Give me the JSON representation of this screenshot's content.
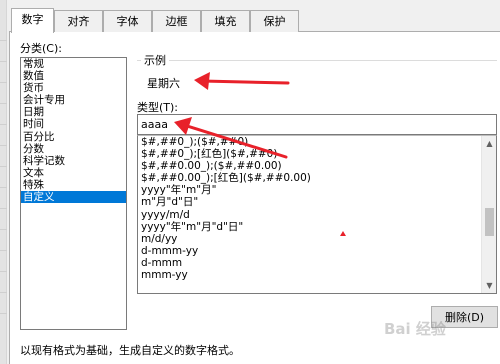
{
  "tabs": [
    {
      "label": "数字",
      "active": true
    },
    {
      "label": "对齐",
      "active": false
    },
    {
      "label": "字体",
      "active": false
    },
    {
      "label": "边框",
      "active": false
    },
    {
      "label": "填充",
      "active": false
    },
    {
      "label": "保护",
      "active": false
    }
  ],
  "category": {
    "label": "分类(C):",
    "items": [
      "常规",
      "数值",
      "货币",
      "会计专用",
      "日期",
      "时间",
      "百分比",
      "分数",
      "科学记数",
      "文本",
      "特殊",
      "自定义"
    ],
    "selected": "自定义"
  },
  "sample": {
    "title": "示例",
    "value": "星期六"
  },
  "type": {
    "label": "类型(T):",
    "value": "aaaa"
  },
  "formats": [
    "$#,##0_);($#,##0)",
    "$#,##0_);[红色]($#,##0)",
    "$#,##0.00_);($#,##0.00)",
    "$#,##0.00_);[红色]($#,##0.00)",
    "yyyy\"年\"m\"月\"",
    "m\"月\"d\"日\"",
    "yyyy/m/d",
    "yyyy\"年\"m\"月\"d\"日\"",
    "m/d/yy",
    "d-mmm-yy",
    "d-mmm",
    "mmm-yy"
  ],
  "delete_button": "删除(D)",
  "note": "以现有格式为基础，生成自定义的数字格式。",
  "watermark": "Bai 经验",
  "colors": {
    "selection": "#0078d7",
    "annotation_arrow": "#e8212a"
  }
}
